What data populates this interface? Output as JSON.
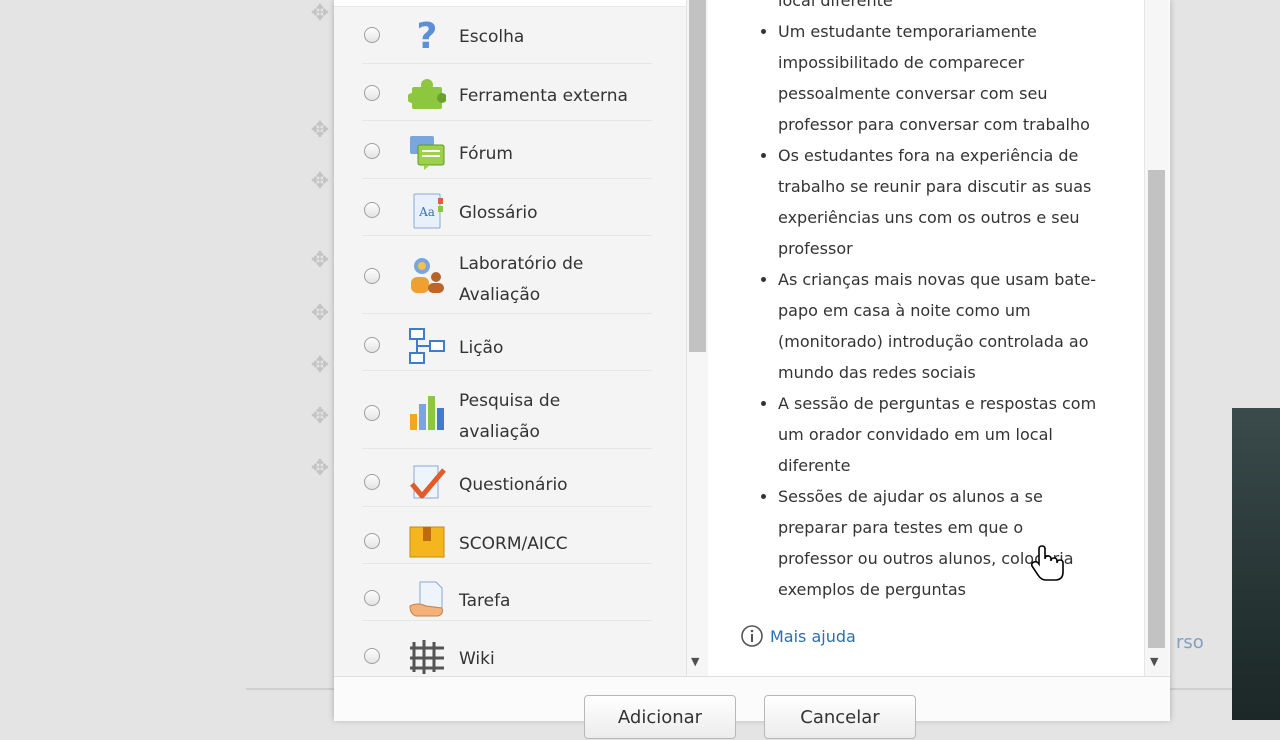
{
  "background": {
    "partial_link": "rso"
  },
  "activities": [
    {
      "label_lines": [
        "Escolha"
      ],
      "icon": "question-mark-icon"
    },
    {
      "label_lines": [
        "Ferramenta externa"
      ],
      "icon": "puzzle-piece-icon"
    },
    {
      "label_lines": [
        "Fórum"
      ],
      "icon": "forum-bubbles-icon"
    },
    {
      "label_lines": [
        "Glossário"
      ],
      "icon": "glossary-book-icon"
    },
    {
      "label_lines": [
        "Laboratório de",
        "Avaliação"
      ],
      "icon": "workshop-people-icon"
    },
    {
      "label_lines": [
        "Lição"
      ],
      "icon": "lesson-flowchart-icon"
    },
    {
      "label_lines": [
        "Pesquisa de",
        "avaliação"
      ],
      "icon": "survey-bar-chart-icon"
    },
    {
      "label_lines": [
        "Questionário"
      ],
      "icon": "quiz-checkmark-icon"
    },
    {
      "label_lines": [
        "SCORM/AICC"
      ],
      "icon": "scorm-package-icon"
    },
    {
      "label_lines": [
        "Tarefa"
      ],
      "icon": "assignment-hand-document-icon"
    },
    {
      "label_lines": [
        "Wiki"
      ],
      "icon": "wiki-grid-icon"
    }
  ],
  "help": {
    "cut_off_first_line": "local diferente",
    "bullets": [
      [
        "Um estudante temporariamente",
        "impossibilitado de comparecer",
        "pessoalmente conversar com seu",
        "professor para conversar com trabalho"
      ],
      [
        "Os estudantes fora na experiência de",
        "trabalho se reunir para discutir as suas",
        "experiências uns com os outros e seu",
        "professor"
      ],
      [
        "As crianças mais novas que usam bate-",
        "papo em casa à noite como um",
        "(monitorado) introdução controlada ao",
        "mundo das redes sociais"
      ],
      [
        "A sessão de perguntas e respostas com",
        "um orador convidado em um local",
        "diferente"
      ],
      [
        "Sessões de ajudar os alunos a se",
        "preparar para testes em que o",
        "professor ou outros alunos, colocaria",
        "exemplos de perguntas"
      ]
    ],
    "more_help_label": "Mais ajuda"
  },
  "buttons": {
    "add_label": "Adicionar",
    "cancel_label": "Cancelar"
  }
}
